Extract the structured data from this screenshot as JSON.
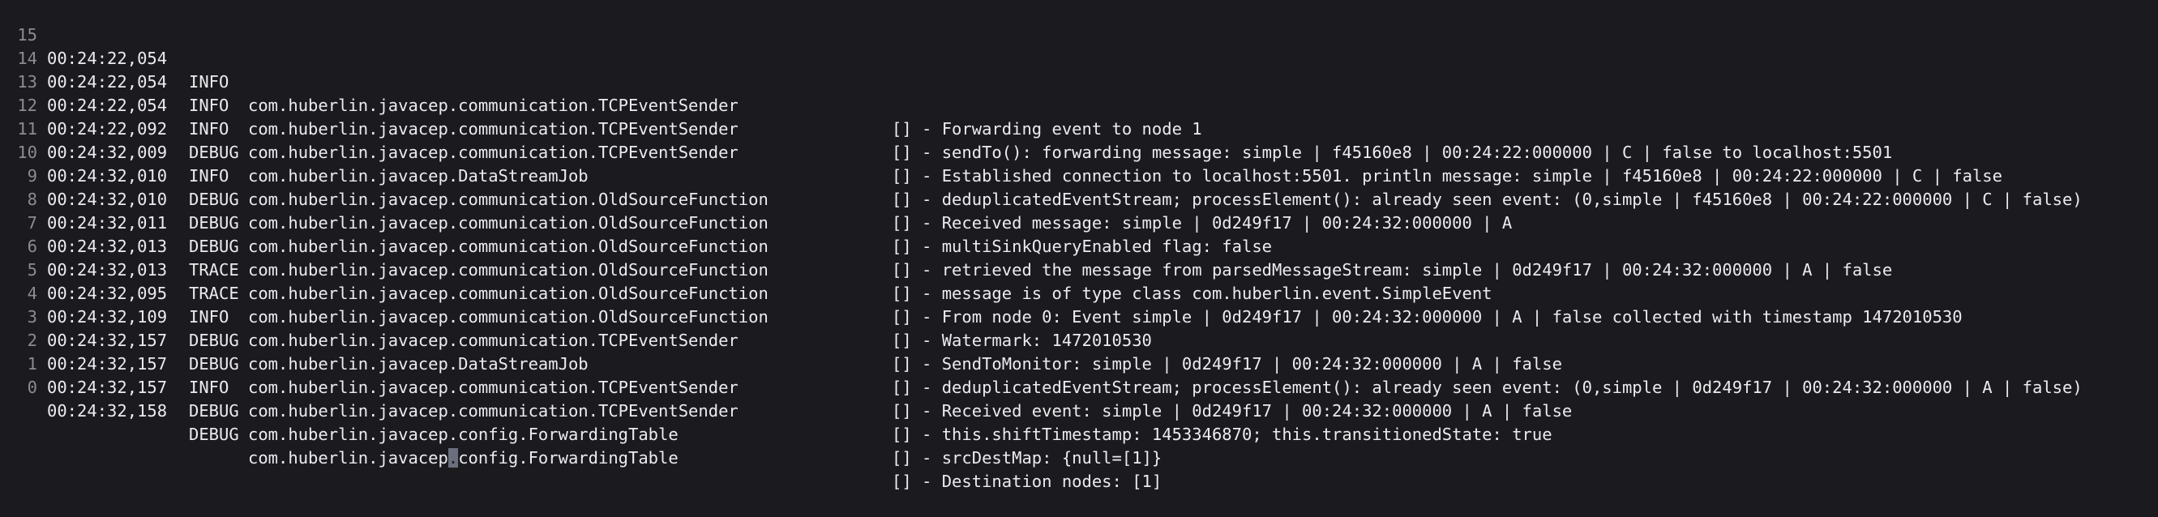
{
  "lines": [
    {
      "num": "15",
      "ts": "00:24:22,054",
      "level": "INFO ",
      "cls": "com.huberlin.javacep.communication.TCPEventSender",
      "msg": "[] - Forwarding event to node 1"
    },
    {
      "num": "14",
      "ts": "00:24:22,054",
      "level": "INFO ",
      "cls": "com.huberlin.javacep.communication.TCPEventSender",
      "msg": "[] - sendTo(): forwarding message: simple | f45160e8 | 00:24:22:000000 | C | false to localhost:5501"
    },
    {
      "num": "13",
      "ts": "00:24:22,054",
      "level": "INFO ",
      "cls": "com.huberlin.javacep.communication.TCPEventSender",
      "msg": "[] - Established connection to localhost:5501. println message: simple | f45160e8 | 00:24:22:000000 | C | false"
    },
    {
      "num": "12",
      "ts": "00:24:22,092",
      "level": "DEBUG",
      "cls": "com.huberlin.javacep.DataStreamJob",
      "msg": "[] - deduplicatedEventStream; processElement(): already seen event: (0,simple | f45160e8 | 00:24:22:000000 | C | false)"
    },
    {
      "num": "11",
      "ts": "00:24:32,009",
      "level": "INFO ",
      "cls": "com.huberlin.javacep.communication.OldSourceFunction",
      "msg": "[] - Received message: simple | 0d249f17 | 00:24:32:000000 | A"
    },
    {
      "num": "10",
      "ts": "00:24:32,010",
      "level": "DEBUG",
      "cls": "com.huberlin.javacep.communication.OldSourceFunction",
      "msg": "[] - multiSinkQueryEnabled flag: false"
    },
    {
      "num": "9",
      "ts": "00:24:32,010",
      "level": "DEBUG",
      "cls": "com.huberlin.javacep.communication.OldSourceFunction",
      "msg": "[] - retrieved the message from parsedMessageStream: simple | 0d249f17 | 00:24:32:000000 | A | false"
    },
    {
      "num": "8",
      "ts": "00:24:32,011",
      "level": "DEBUG",
      "cls": "com.huberlin.javacep.communication.OldSourceFunction",
      "msg": "[] - message is of type class com.huberlin.event.SimpleEvent"
    },
    {
      "num": "7",
      "ts": "00:24:32,013",
      "level": "TRACE",
      "cls": "com.huberlin.javacep.communication.OldSourceFunction",
      "msg": "[] - From node 0: Event simple | 0d249f17 | 00:24:32:000000 | A | false collected with timestamp 1472010530"
    },
    {
      "num": "6",
      "ts": "00:24:32,013",
      "level": "TRACE",
      "cls": "com.huberlin.javacep.communication.OldSourceFunction",
      "msg": "[] - Watermark: 1472010530"
    },
    {
      "num": "5",
      "ts": "00:24:32,095",
      "level": "INFO ",
      "cls": "com.huberlin.javacep.communication.TCPEventSender",
      "msg": "[] - SendToMonitor: simple | 0d249f17 | 00:24:32:000000 | A | false"
    },
    {
      "num": "4",
      "ts": "00:24:32,109",
      "level": "DEBUG",
      "cls": "com.huberlin.javacep.DataStreamJob",
      "msg": "[] - deduplicatedEventStream; processElement(): already seen event: (0,simple | 0d249f17 | 00:24:32:000000 | A | false)"
    },
    {
      "num": "3",
      "ts": "00:24:32,157",
      "level": "DEBUG",
      "cls": "com.huberlin.javacep.communication.TCPEventSender",
      "msg": "[] - Received event: simple | 0d249f17 | 00:24:32:000000 | A | false"
    },
    {
      "num": "2",
      "ts": "00:24:32,157",
      "level": "INFO ",
      "cls": "com.huberlin.javacep.communication.TCPEventSender",
      "msg": "[] - this.shiftTimestamp: 1453346870; this.transitionedState: true"
    },
    {
      "num": "1",
      "ts": "00:24:32,157",
      "level": "DEBUG",
      "cls": "com.huberlin.javacep.config.ForwardingTable",
      "msg": "[] - srcDestMap: {null=[1]}"
    },
    {
      "num": "0",
      "ts": "00:24:32,158",
      "level": "DEBUG",
      "cls_before_cursor": "com.huberlin.javacep",
      "cls_cursor": ".",
      "cls_after_cursor": "config.ForwardingTable",
      "msg": "[] - Destination nodes: [1]"
    }
  ],
  "colors": {
    "background": "#1b1b1f",
    "text": "#ececef",
    "line_number": "#8b8b93",
    "cursor": "#6b6f7d"
  }
}
